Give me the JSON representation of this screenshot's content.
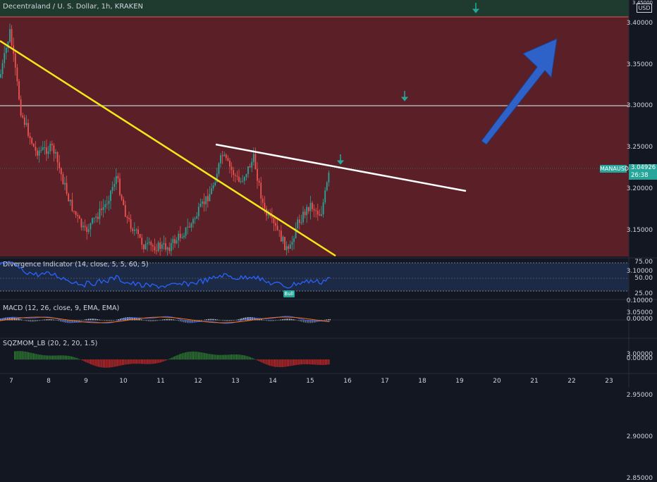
{
  "header": {
    "title": "Decentraland / U. S. Dollar, 1h, KRAKEN",
    "currency": "USD",
    "top_price_label": "3.45000"
  },
  "price_axis": {
    "labels": [
      "3.40000",
      "3.35000",
      "3.30000",
      "3.25000",
      "3.20000",
      "3.15000",
      "3.10000",
      "3.05000",
      "3.00000",
      "2.95000",
      "2.90000",
      "2.85000"
    ]
  },
  "current_price": {
    "symbol": "MANAUSD",
    "value": "3.04926",
    "countdown": "26:38"
  },
  "panels": {
    "divergence": {
      "title": "Divergence Indicator (14, close, 5, 5, 60, 5)",
      "axis": [
        "75.00",
        "50.00",
        "25.00"
      ],
      "bull_label": "Bull"
    },
    "macd": {
      "title": "MACD (12, 26, close, 9, EMA, EMA)",
      "axis": [
        "0.10000",
        "0.00000"
      ]
    },
    "sqzmom": {
      "title": "SQZMOM_LB (20, 2, 20, 1.5)",
      "axis": [
        "0.00000"
      ]
    }
  },
  "time_axis": {
    "labels": [
      "7",
      "8",
      "9",
      "10",
      "11",
      "12",
      "13",
      "14",
      "15",
      "16",
      "17",
      "18",
      "19",
      "20",
      "21",
      "22",
      "23"
    ]
  },
  "colors": {
    "background": "#131722",
    "zone_red": "#5a1e24",
    "zone_green": "#1e3d2e",
    "up": "#26a69a",
    "down": "#ef5350",
    "trend_yellow": "#f5e71a",
    "trend_white": "#ffffff",
    "arrow_blue": "#2f62c9",
    "rsi_line": "#2962ff"
  },
  "icons": [
    "down-arrow-icon",
    "down-arrow-icon",
    "down-arrow-icon",
    "blue-up-arrow-icon"
  ]
}
